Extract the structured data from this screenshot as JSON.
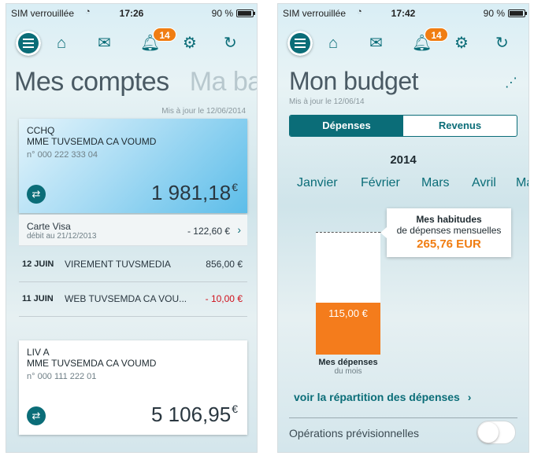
{
  "left": {
    "status": {
      "carrier": "SIM verrouillée",
      "time": "17:26",
      "battery": "90 %"
    },
    "toolbar": {
      "badge": "14"
    },
    "title": "Mes comptes",
    "next_title": "Ma ba",
    "updated": "Mis à jour le 12/06/2014",
    "account1": {
      "name": "CCHQ",
      "holder": "MME TUVSEMDA CA VOUMD",
      "number": "n° 000 222 333 04",
      "balance": "1 981,18",
      "currency": "€"
    },
    "card": {
      "title": "Carte Visa",
      "subtitle": "débit au 21/12/2013",
      "amount": "- 122,60 €"
    },
    "transactions": [
      {
        "date": "12 JUIN",
        "label": "VIREMENT TUVSMEDIA",
        "amount": "856,00 €"
      },
      {
        "date": "11 JUIN",
        "label": "WEB TUVSEMDA CA VOU...",
        "amount": "- 10,00 €"
      }
    ],
    "account2": {
      "name": "LIV A",
      "holder": "MME TUVSEMDA CA VOUMD",
      "number": "n° 000 111 222 01",
      "balance": "5 106,95",
      "currency": "€"
    }
  },
  "right": {
    "status": {
      "carrier": "SIM verrouillée",
      "time": "17:42",
      "battery": "90 %"
    },
    "toolbar": {
      "badge": "14"
    },
    "title": "Mon budget",
    "updated": "Mis à jour le 12/06/14",
    "segment": {
      "active": "Dépenses",
      "inactive": "Revenus"
    },
    "year": "2014",
    "months": [
      "Janvier",
      "Février",
      "Mars",
      "Avril",
      "Ma"
    ],
    "spent_ratio": 0.42,
    "spent_value": "115,00 €",
    "bar_caption": {
      "line1": "Mes dépenses",
      "line2": "du mois"
    },
    "tooltip": {
      "line1": "Mes habitudes",
      "line2": "de dépenses mensuelles",
      "value": "265,76 EUR"
    },
    "link": "voir la répartition des dépenses",
    "link_chevron": "›",
    "option_label": "Opérations prévisionnelles"
  },
  "icons": {
    "wifi": "wifi-icon",
    "home": "home-icon",
    "mail": "mail-icon",
    "bell": "bell-icon",
    "gear": "gear-icon",
    "refresh": "refresh-icon",
    "menu": "menu-icon",
    "transfer": "transfer-icon",
    "trend": "trend-icon",
    "chevron": "chevron-right-icon"
  },
  "colors": {
    "primary": "#0b6d78",
    "accent": "#f07d12",
    "negative": "#d0111b",
    "bar_spent": "#f47c1c"
  }
}
